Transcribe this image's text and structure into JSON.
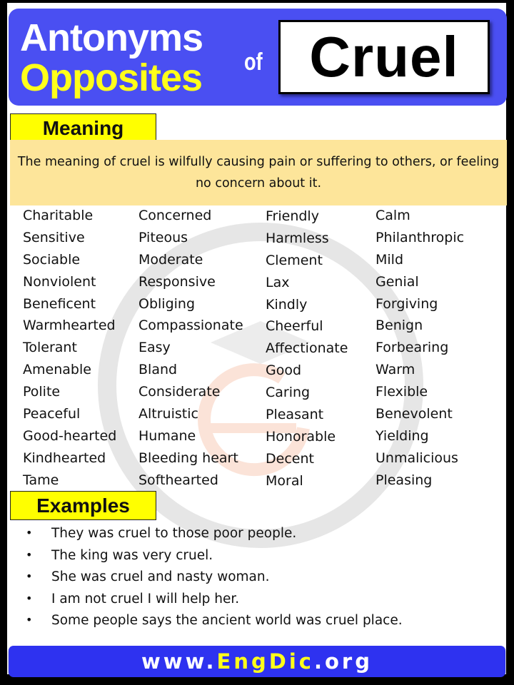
{
  "header": {
    "title_line1": "Antonyms",
    "title_line2": "Opposites",
    "connector": "of",
    "word": "Cruel",
    "colors": {
      "banner": "#4a4ff2",
      "line1": "#ffffff",
      "line2": "#ffff1a"
    }
  },
  "meaning": {
    "label": "Meaning",
    "text": "The meaning of cruel is wilfully causing pain or suffering to others, or feeling no concern about it.",
    "colors": {
      "label_bg": "#ffff00",
      "box_bg": "#fde59a"
    }
  },
  "antonyms": {
    "columns": [
      [
        "Charitable",
        "Sensitive",
        "Sociable",
        "Nonviolent",
        "Beneficent",
        "Warmhearted",
        "Tolerant",
        "Amenable",
        "Polite",
        "Peaceful",
        "Good-hearted",
        "Kindhearted",
        "Tame"
      ],
      [
        "Concerned",
        "Piteous",
        "Moderate",
        "Responsive",
        "Obliging",
        "Compassionate",
        "Easy",
        "Bland",
        "Considerate",
        "Altruistic",
        "Humane",
        "Bleeding heart",
        "Softhearted"
      ],
      [
        "Friendly",
        "Harmless",
        "Clement",
        "Lax",
        "Kindly",
        "Cheerful",
        "Affectionate",
        "Good",
        "Caring",
        "Pleasant",
        "Honorable",
        "Decent",
        "Moral"
      ],
      [
        "Calm",
        "Philanthropic",
        "Mild",
        "Genial",
        "Forgiving",
        "Benign",
        "Forbearing",
        "Warm",
        "Flexible",
        "Benevolent",
        "Yielding",
        "Unmalicious",
        "Pleasing"
      ]
    ]
  },
  "examples": {
    "label": "Examples",
    "bullet": "•",
    "items": [
      "They was cruel to those poor people.",
      "The king was very cruel.",
      "She was cruel and nasty woman.",
      "I am not cruel I will help her.",
      "Some people says the ancient world was cruel place."
    ]
  },
  "watermark": {
    "text": "www.EngDic.org",
    "icon": "engdic-logo-icon"
  },
  "footer": {
    "prefix": "www.",
    "brand": "EngDic",
    "suffix": ".org",
    "colors": {
      "bg": "#2e32f0",
      "text": "#ffffff",
      "brand": "#ffff1a"
    }
  }
}
